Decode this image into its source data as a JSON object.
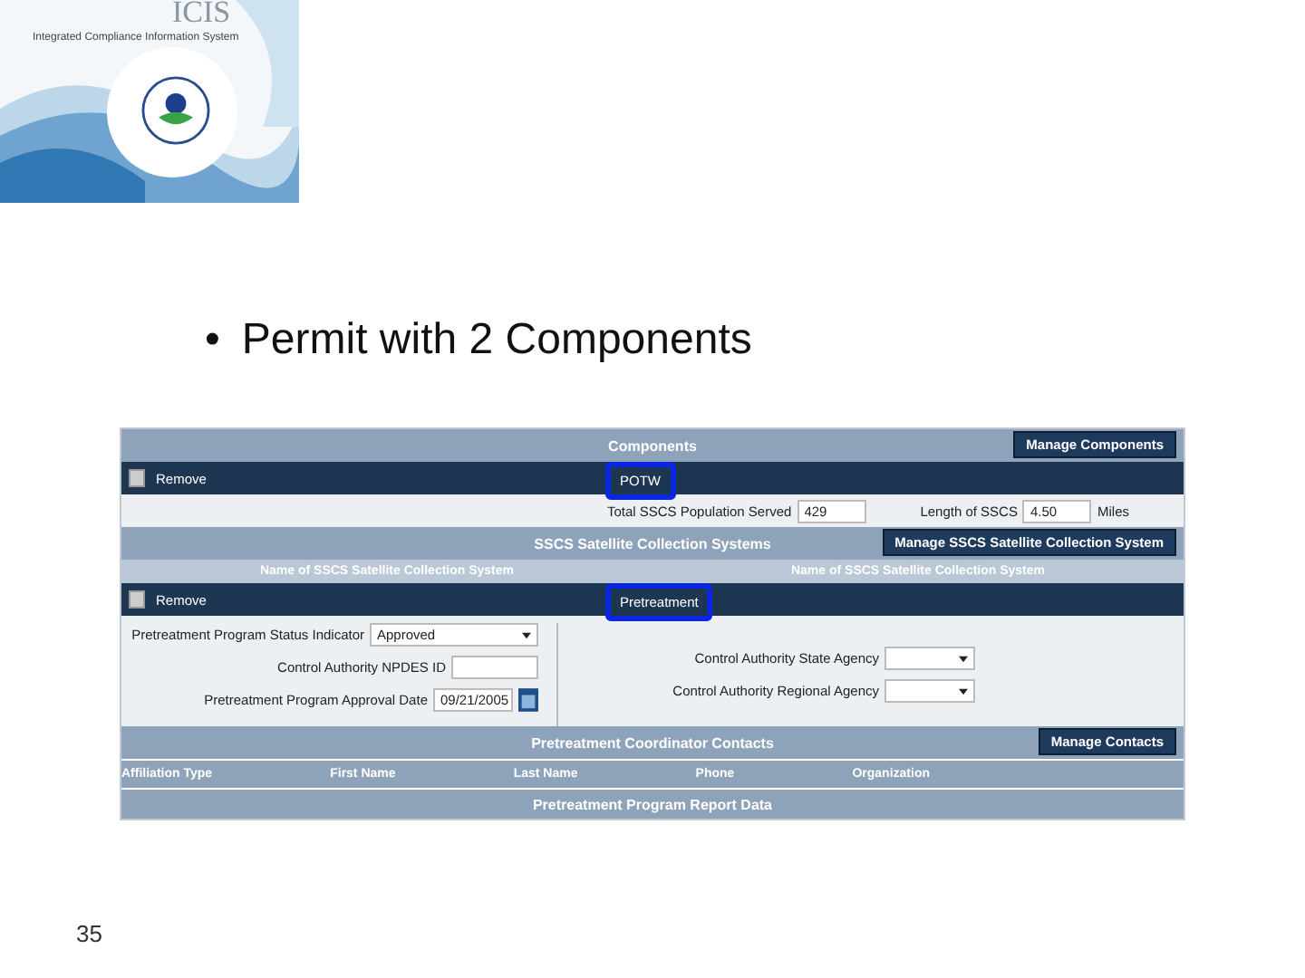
{
  "banner": {
    "subtitle": "Integrated Compliance Information System",
    "logo_text": "ICIS"
  },
  "bullet": {
    "mark": "•",
    "text": "Permit with 2 Components"
  },
  "form": {
    "components": {
      "title": "Components",
      "button": "Manage Components"
    },
    "potw": {
      "remove": "Remove",
      "checked": false,
      "label": "POTW"
    },
    "potw_fields": [
      {
        "label": "Total SSCS Population Served",
        "value": "429"
      },
      {
        "label": "Length of SSCS",
        "value": "4.50",
        "unit": "Miles"
      }
    ],
    "sscs": {
      "title": "SSCS Satellite Collection Systems",
      "button": "Manage SSCS Satellite Collection System",
      "columns": [
        "Name of SSCS Satellite Collection System",
        "Name of SSCS Satellite Collection System"
      ]
    },
    "pretreatment": {
      "remove": "Remove",
      "checked": false,
      "label": "Pretreatment"
    },
    "left_fields": [
      {
        "kind": "select",
        "label": "Pretreatment Program Status Indicator",
        "value": "Approved"
      },
      {
        "kind": "text",
        "label": "Control Authority NPDES ID"
      },
      {
        "kind": "date",
        "label": "Pretreatment Program Approval Date",
        "value": "09/21/2005"
      }
    ],
    "right_fields": [
      {
        "kind": "select",
        "label": "Control Authority State Agency"
      },
      {
        "kind": "select",
        "label": "Control Authority Regional Agency"
      }
    ],
    "contacts": {
      "title": "Pretreatment Coordinator Contacts",
      "button": "Manage Contacts",
      "columns": [
        "Affiliation Type",
        "First Name",
        "Last Name",
        "Phone",
        "Organization"
      ]
    },
    "report": {
      "title": "Pretreatment Program Report Data"
    }
  },
  "slide_number": "35"
}
